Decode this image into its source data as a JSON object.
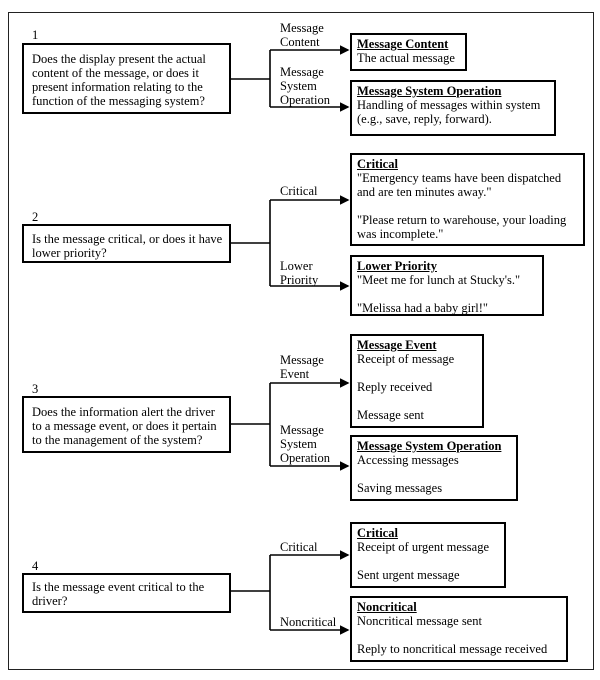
{
  "sections": [
    {
      "number": "1",
      "question": "Does the display present the actual content of the message, or does it present information relating to the function of the messaging system?",
      "branches": [
        {
          "label": "Message Content",
          "title": "Message Content",
          "items": [
            "The actual message"
          ]
        },
        {
          "label": "Message System Operation",
          "title": "Message System Operation",
          "items": [
            "Handling of messages within system (e.g., save, reply, forward)."
          ]
        }
      ]
    },
    {
      "number": "2",
      "question": "Is the message critical, or does it have lower priority?",
      "branches": [
        {
          "label": "Critical",
          "title": "Critical",
          "items": [
            "\"Emergency teams have been dispatched and are ten minutes away.\"",
            "\"Please return to warehouse, your loading was incomplete.\""
          ]
        },
        {
          "label": "Lower Priority",
          "title": "Lower Priority",
          "items": [
            "\"Meet me for lunch at Stucky's.\"",
            "\"Melissa had a baby girl!\""
          ]
        }
      ]
    },
    {
      "number": "3",
      "question": "Does the information alert the driver to a message event, or does it pertain to the management of the system?",
      "branches": [
        {
          "label": "Message Event",
          "title": "Message Event",
          "items": [
            "Receipt of message",
            "Reply received",
            "Message sent"
          ]
        },
        {
          "label": "Message System Operation",
          "title": "Message System Operation",
          "items": [
            "Accessing messages",
            "Saving messages"
          ]
        }
      ]
    },
    {
      "number": "4",
      "question": "Is the message event critical to the driver?",
      "branches": [
        {
          "label": "Critical",
          "title": "Critical",
          "items": [
            "Receipt of urgent message",
            "Sent urgent message"
          ]
        },
        {
          "label": "Noncritical",
          "title": "Noncritical",
          "items": [
            "Noncritical message sent",
            "Reply to noncritical message received"
          ]
        }
      ]
    }
  ]
}
